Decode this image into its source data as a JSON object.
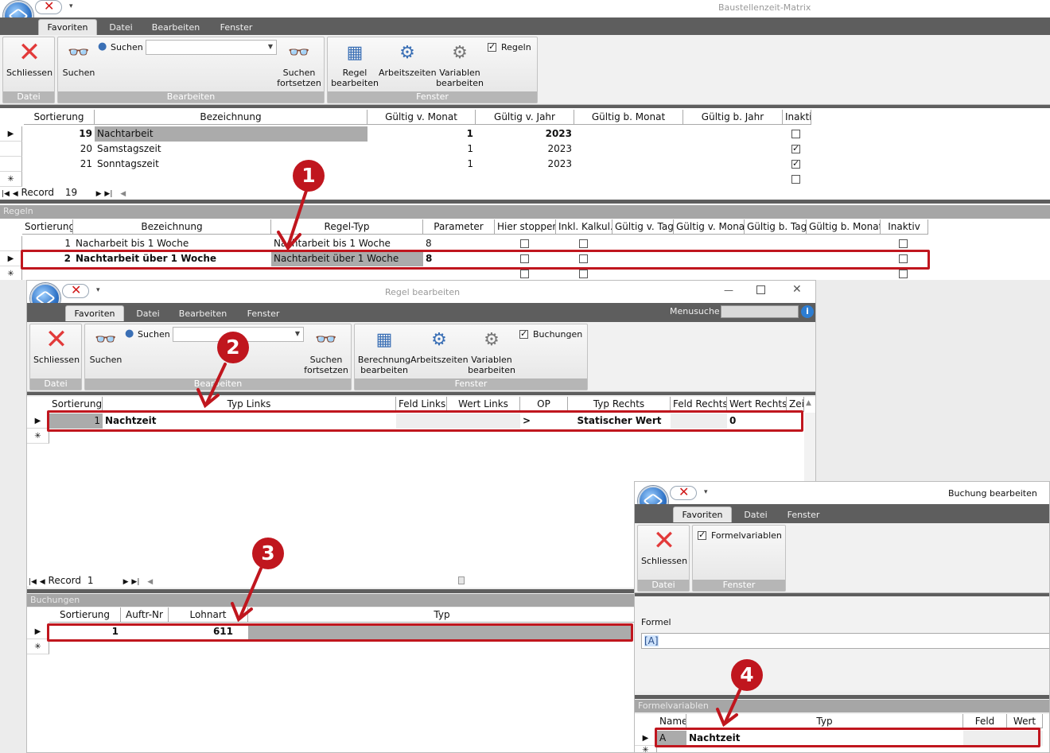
{
  "main": {
    "title": "Baustellenzeit-Matrix",
    "tabs": [
      "Favoriten",
      "Datei",
      "Bearbeiten",
      "Fenster"
    ],
    "ribbon": {
      "close": "Schliessen",
      "search": "Suchen",
      "search_label": "Suchen",
      "search_next": "Suchen fortsetzen",
      "rule_edit": "Regel bearbeiten",
      "work_times": "Arbeitszeiten",
      "var_edit": "Variablen bearbeiten",
      "rules_check": "Regeln",
      "g_datei": "Datei",
      "g_bearbeiten": "Bearbeiten",
      "g_fenster": "Fenster"
    },
    "grid": {
      "headers": [
        "Sortierung",
        "Bezeichnung",
        "Gültig v. Monat",
        "Gültig v. Jahr",
        "Gültig b. Monat",
        "Gültig b. Jahr",
        "Inakti"
      ],
      "rows": [
        {
          "sort": "19",
          "name": "Nachtarbeit",
          "month": "1",
          "year": "2023",
          "inactive": false
        },
        {
          "sort": "20",
          "name": "Samstagszeit",
          "month": "1",
          "year": "2023",
          "inactive": true
        },
        {
          "sort": "21",
          "name": "Sonntagszeit",
          "month": "1",
          "year": "2023",
          "inactive": true
        }
      ],
      "record_label": "Record",
      "record_value": "19"
    }
  },
  "rules": {
    "band": "Regeln",
    "headers": [
      "Sortierung",
      "Bezeichnung",
      "Regel-Typ",
      "Parameter",
      "Hier stoppen",
      "Inkl. Kalkul.",
      "Gültig v. Tag",
      "Gültig v. Monat",
      "Gültig b. Tag",
      "Gültig b. Monat",
      "Inaktiv"
    ],
    "rows": [
      {
        "sort": "1",
        "name": "Nacharbeit bis 1 Woche",
        "type": "Nachtarbeit bis 1 Woche",
        "param": "8"
      },
      {
        "sort": "2",
        "name": "Nachtarbeit über 1 Woche",
        "type": "Nachtarbeit über 1 Woche",
        "param": "8"
      }
    ]
  },
  "rule_win": {
    "title": "Regel bearbeiten",
    "tabs": [
      "Favoriten",
      "Datei",
      "Bearbeiten",
      "Fenster"
    ],
    "menusuche": "Menusuche",
    "ribbon": {
      "close": "Schliessen",
      "search": "Suchen",
      "search_label": "Suchen",
      "search_next": "Suchen fortsetzen",
      "calc_edit": "Berechnung bearbeiten",
      "work_times": "Arbeitszeiten",
      "var_edit": "Variablen bearbeiten",
      "bookings_check": "Buchungen",
      "g_datei": "Datei",
      "g_bearbeiten": "Bearbeiten",
      "g_fenster": "Fenster"
    },
    "grid": {
      "headers": [
        "Sortierung",
        "Typ Links",
        "Feld Links",
        "Wert Links",
        "OP",
        "Typ Rechts",
        "Feld Rechts",
        "Wert Rechts",
        "Zei"
      ],
      "row": {
        "sort": "1",
        "typ_links": "Nachtzeit",
        "op": ">",
        "typ_rechts": "Statischer Wert",
        "wert_rechts": "0"
      },
      "record_label": "Record",
      "record_value": "1"
    },
    "bookings": {
      "band": "Buchungen",
      "headers": [
        "Sortierung",
        "Auftr-Nr",
        "Lohnart",
        "Typ"
      ],
      "row": {
        "sort": "1",
        "lohnart": "611"
      }
    }
  },
  "booking_win": {
    "title": "Buchung bearbeiten",
    "tabs": [
      "Favoriten",
      "Datei",
      "Fenster"
    ],
    "ribbon": {
      "close": "Schliessen",
      "formula_vars": "Formelvariablen",
      "g_datei": "Datei",
      "g_fenster": "Fenster"
    },
    "formel_label": "Formel",
    "formel_value": "[A]",
    "vars": {
      "band": "Formelvariablen",
      "headers": [
        "Name",
        "Typ",
        "Feld",
        "Wert"
      ],
      "row": {
        "name": "A",
        "typ": "Nachtzeit"
      }
    }
  },
  "callouts": [
    "1",
    "2",
    "3",
    "4"
  ],
  "colors": {
    "accent": "#c0161e",
    "tabbar": "#5e5e5e",
    "selected_cell": "#ababab"
  }
}
